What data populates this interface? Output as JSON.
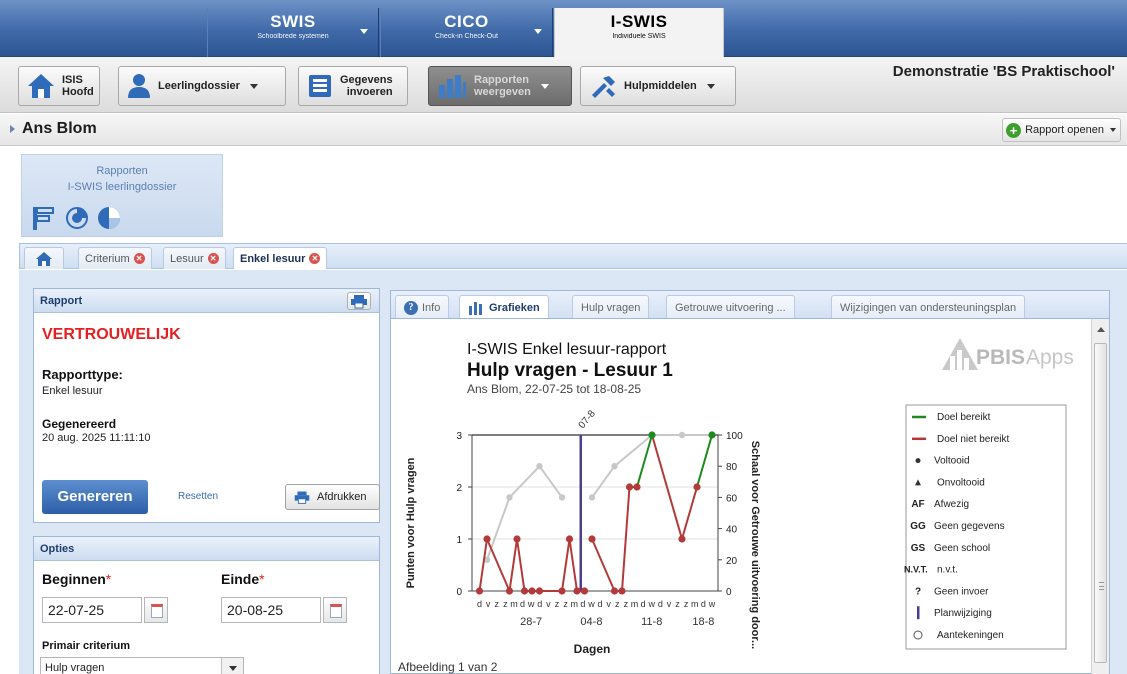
{
  "product_tabs": [
    {
      "title": "SWIS",
      "subtitle": "Schoolbrede systemen",
      "active": false
    },
    {
      "title": "CICO",
      "subtitle": "Check-in Check-Out",
      "active": false
    },
    {
      "title": "I-SWIS",
      "subtitle": "Individuele SWIS",
      "active": true
    }
  ],
  "toolbar": {
    "isis_l1": "ISIS",
    "isis_l2": "Hoofd",
    "dossier": "Leerlingdossier",
    "gegevens_l1": "Gegevens",
    "gegevens_l2": "invoeren",
    "rapporten_l1": "Rapporten",
    "rapporten_l2": "weergeven",
    "hulpmiddelen": "Hulpmiddelen",
    "demo": "Demonstratie 'BS Praktischool'"
  },
  "student_name": "Ans Blom",
  "open_report": "Rapport openen",
  "rapbox": {
    "line1": "Rapporten",
    "line2": "I-SWIS leerlingdossier"
  },
  "page_tabs": [
    "Criterium",
    "Lesuur",
    "Enkel lesuur"
  ],
  "rapport": {
    "header": "Rapport",
    "confidential": "VERTROUWELIJK",
    "type_label": "Rapporttype:",
    "type_value": "Enkel lesuur",
    "gen_label": "Gegenereerd",
    "gen_value": "20 aug. 2025 11:11:10",
    "generate": "Genereren",
    "reset": "Resetten",
    "print": "Afdrukken"
  },
  "opties": {
    "header": "Opties",
    "begin_label": "Beginnen",
    "end_label": "Einde",
    "required_mark": "*",
    "begin_value": "22-07-25",
    "end_value": "20-08-25",
    "criterium_label": "Primair criterium",
    "criterium_value": "Hulp vragen"
  },
  "report_tabs": [
    "Info",
    "Grafieken",
    "Hulp vragen",
    "Getrouwe uitvoering ...",
    "Wijzigingen van ondersteuningsplan"
  ],
  "chart_header": {
    "l1": "I-SWIS Enkel lesuur-rapport",
    "l2": "Hulp vragen - Lesuur 1",
    "l3": "Ans Blom, 22-07-25 tot 18-08-25",
    "logo": "PBISApps"
  },
  "caption": "Afbeelding 1 van 2",
  "colors": {
    "met": "#1e8a1e",
    "notmet": "#b33a3a",
    "fidelity": "#c8c8c8",
    "plan": "#4a3f8f"
  },
  "chart_data": {
    "type": "line",
    "xlabel": "Dagen",
    "ylabel": "Punten voor Hulp vragen",
    "y2label": "Schaal voor Getrouwe uitvoering door...",
    "ylim": [
      0,
      3
    ],
    "y2lim": [
      0,
      100
    ],
    "yticks": [
      "0",
      "1",
      "2",
      "3"
    ],
    "y2ticks": [
      "0",
      "20",
      "40",
      "60",
      "80",
      "100"
    ],
    "day_labels": [
      "d",
      "v",
      "z",
      "z",
      "m",
      "d",
      "w",
      "d",
      "v",
      "z",
      "z",
      "m",
      "d",
      "w",
      "d",
      "v",
      "z",
      "z",
      "m",
      "d",
      "w",
      "d",
      "v",
      "z",
      "z",
      "m",
      "d",
      "w"
    ],
    "week_labels": [
      {
        "day": 6,
        "label": "28-7"
      },
      {
        "day": 13,
        "label": "04-8"
      },
      {
        "day": 20,
        "label": "11-8"
      },
      {
        "day": 26,
        "label": "18-8"
      }
    ],
    "plan_change": {
      "day": 14.5,
      "label": "07-8"
    },
    "series": [
      {
        "segments": [
          [
            [
              1,
              0
            ],
            [
              2,
              1
            ],
            [
              5,
              0
            ],
            [
              6,
              1
            ],
            [
              7,
              0
            ],
            [
              8,
              0
            ],
            [
              9,
              0
            ],
            [
              12,
              0
            ],
            [
              13,
              1
            ],
            [
              14,
              0
            ],
            [
              15,
              0
            ]
          ],
          [
            [
              16,
              1
            ],
            [
              19,
              0
            ],
            [
              20,
              0
            ],
            [
              21,
              2
            ],
            [
              22,
              2
            ],
            [
              24,
              3
            ],
            [
              28,
              1
            ],
            [
              30,
              2
            ],
            [
              32,
              3
            ]
          ]
        ]
      },
      {
        "axis": "y2",
        "segments": [
          [
            [
              2,
              20
            ],
            [
              5,
              60
            ],
            [
              9,
              80
            ],
            [
              12,
              60
            ]
          ],
          [
            [
              16,
              60
            ],
            [
              19,
              80
            ],
            [
              24,
              100
            ],
            [
              28,
              100
            ],
            [
              32,
              100
            ]
          ]
        ]
      }
    ],
    "legend": [
      {
        "label": "Doel bereikt",
        "symbol": "line-green"
      },
      {
        "label": "Doel niet bereikt",
        "symbol": "line-red"
      },
      {
        "label": "Voltooid",
        "symbol": "dot"
      },
      {
        "label": "Onvoltooid",
        "symbol": "triangle"
      },
      {
        "label": "Afwezig",
        "symbol": "AF"
      },
      {
        "label": "Geen gegevens",
        "symbol": "GG"
      },
      {
        "label": "Geen school",
        "symbol": "GS"
      },
      {
        "label": "n.v.t.",
        "symbol": "N.V.T."
      },
      {
        "label": "Geen invoer",
        "symbol": "?"
      },
      {
        "label": "Planwijziging",
        "symbol": "bar"
      },
      {
        "label": "Aantekeningen",
        "symbol": "circle"
      }
    ]
  }
}
